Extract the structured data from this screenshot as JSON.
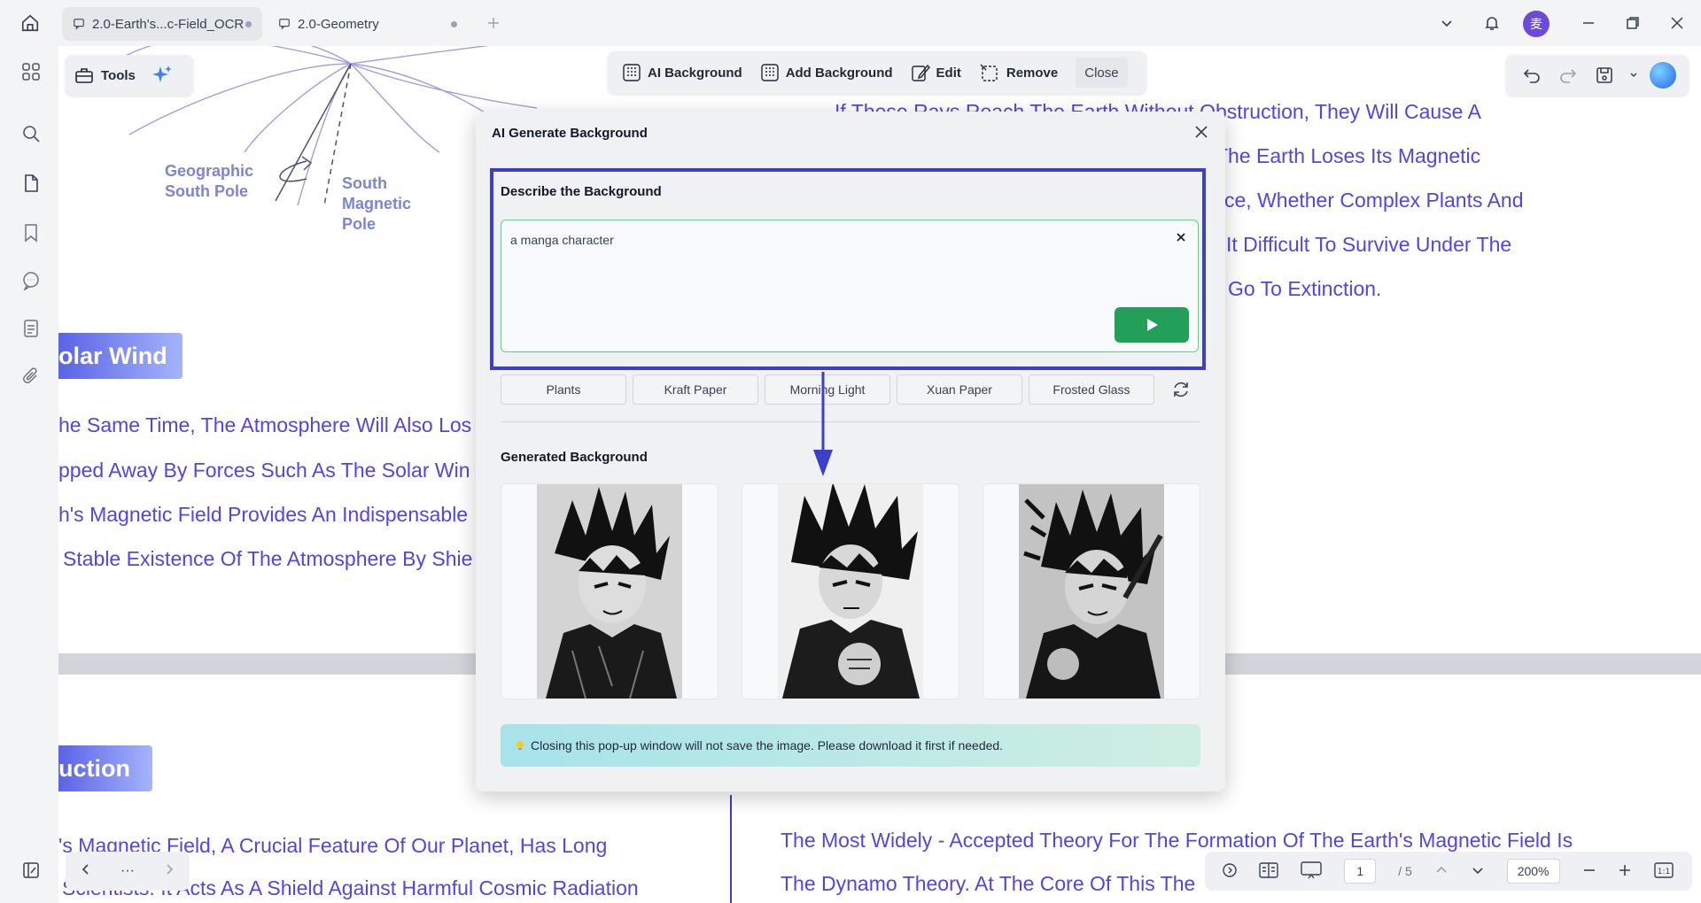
{
  "tabs": [
    {
      "label": "2.0-Earth's...c-Field_OCR",
      "active": true
    },
    {
      "label": "2.0-Geometry",
      "active": false
    }
  ],
  "avatar": {
    "initial": "麦",
    "color": "#6d4bd8"
  },
  "toolbar": {
    "tools_label": "Tools",
    "ai_background": "AI Background",
    "add_background": "Add Background",
    "edit": "Edit",
    "remove": "Remove",
    "close": "Close"
  },
  "document": {
    "diagram_labels": {
      "geo_south_pole": "Geographic South Pole",
      "south_magnetic_pole": "South Magnetic Pole"
    },
    "right_top_lines": [
      "If These Rays Reach The Earth Without Obstruction, They Will Cause A",
      "The Earth Loses Its Magnetic",
      "ce, Whether Complex Plants And",
      "It Difficult To Survive Under The",
      "Go To Extinction."
    ],
    "heading_solar": "olar Wind",
    "left_lines": [
      "he Same Time, The Atmosphere Will Also Los",
      "pped Away By Forces Such As The Solar Win",
      "h's Magnetic Field Provides An Indispensable",
      "Stable Existence Of The Atmosphere By Shie"
    ],
    "heading_intro": "uction",
    "bottom_left_lines": [
      "'s Magnetic Field, A Crucial Feature Of Our Planet, Has Long",
      "Scientists. It Acts As A Shield Against Harmful Cosmic Radiation"
    ],
    "bottom_right_lines": [
      "The Most Widely - Accepted Theory For The Formation Of The Earth's Magnetic Field Is",
      "The Dynamo Theory. At The Core Of This The"
    ]
  },
  "modal": {
    "title": "AI Generate Background",
    "describe_label": "Describe the Background",
    "prompt_value": "a manga character",
    "presets": [
      "Plants",
      "Kraft Paper",
      "Morning Light",
      "Xuan Paper",
      "Frosted Glass"
    ],
    "generated_label": "Generated Background",
    "notice": "Closing this pop-up window will not save the image. Please download it first if needed."
  },
  "bottom_bar": {
    "more": "···",
    "current_page": "1",
    "total_pages": "/ 5",
    "zoom": "200%"
  },
  "colors": {
    "accent": "#3b3fc9",
    "doc_text": "#4f46e5",
    "send": "#22a05a"
  }
}
